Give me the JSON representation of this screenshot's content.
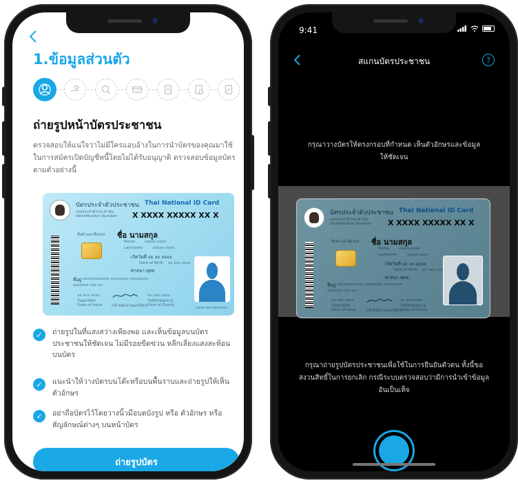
{
  "left": {
    "back_icon": "chevron-left-icon",
    "title": "1.ข้อมูลส่วนตัว",
    "steps": [
      {
        "icon": "person-icon",
        "active": true
      },
      {
        "icon": "hand-money-icon",
        "active": false
      },
      {
        "icon": "coin-search-icon",
        "active": false
      },
      {
        "icon": "card-icon",
        "active": false
      },
      {
        "icon": "document-icon",
        "active": false
      },
      {
        "icon": "document-check-icon",
        "active": false
      },
      {
        "icon": "document-edit-icon",
        "active": false
      }
    ],
    "heading": "ถ่ายรูปหน้าบัตรประชาชน",
    "description": "ตรวจสอบให้แน่ใจว่าไม่มีใครแอบอ้างในการนำบัตรของคุณมาใช้ในการสมัครเปิดบัญชีหนี้โดยไม่ได้รับอนุญาติ ตรวจสอบข้อมูลบัตรตามตัวอย่างนี้",
    "card": {
      "title_th": "บัตรประจำตัวประชาชน",
      "title_en": "Thai National ID Card",
      "id_label_th": "เลขประจำตัวประชาชน",
      "id_label_en": "Identification Number",
      "id_number": "X XXXX XXXXX XX X",
      "name_label": "ชื่อตัวและชื่อสกุล",
      "name_value": "ชื่อ นามสกุล",
      "name_en_label": "Name",
      "name_en_value": "xxxxx xxxx",
      "lastname_en_label": "Lastname",
      "lastname_en_value": "xxxxx xxxx",
      "dob_th": "เกิดวันที่ xx xx xxxx",
      "dob_en_label": "Date of Birth",
      "dob_en_value": "xx xxx xxxx",
      "religion": "ศาสนา พุทธ",
      "address_label": "ที่อยู่",
      "address_value": "xxxxxxxxxxxx xxxxxxxx xxxxxxxx",
      "address_line2": "xxxxxxx xxx xx",
      "issue_th": "วันออกบัตร",
      "issue_en": "Date of Issue",
      "issue_value": "xx xxx xxxx",
      "expiry_th": "วันบัตรหมดอายุ",
      "expiry_en": "Date of Expiry",
      "expiry_value": "xx xxx xxxx",
      "officer_label": "(เจ้าพนักงานออกบัตร)",
      "serial": "xxxx-xx-xxxxxxx"
    },
    "bullets": [
      "ถ่ายรูปในที่แสงสว่างเพียงพอ และเห็นข้อมูลบนบัตรประชาชนให้ชัดเจน ไม่มีรอยขีดข่วน หลีกเลี่ยงแสงสะท้อนบนบัตร",
      "แนะนำให้วางบัตรบนโต๊ะหรือบนพื้นราบและถ่ายรูปให้เห็นตัวอักษร",
      "อย่าถือบัตรไว้โดยวางนิ้วมือบดบังรูป หรือ ตัวอักษร หรือ สัญลักษณ์ต่างๆ บนหน้าบัตร"
    ],
    "cta_label": "ถ่ายรูปบัตร"
  },
  "right": {
    "status_time": "9:41",
    "back_icon": "chevron-left-icon",
    "title": "สแกนบัตรประชาชน",
    "help_icon": "question-icon",
    "help_label": "?",
    "instruction": "กรุณาวางบัตรให้ตรงกรอบที่กำหนด เห็นตัวอักษรและข้อมูลให้ชัดเจน",
    "note": "กรุณาถ่ายรูปบัตรประชาชนเพื่อใช้ในการยืนยันตัวตน ทั้งนี้ขอสงวนสิทธิ์ในการยกเลิก กรณีระบบตรวจสอบว่ามีการนำเข้าข้อมูลอันเป็นเท็จ"
  },
  "colors": {
    "accent": "#1aa7e6",
    "dark": "#000000"
  }
}
